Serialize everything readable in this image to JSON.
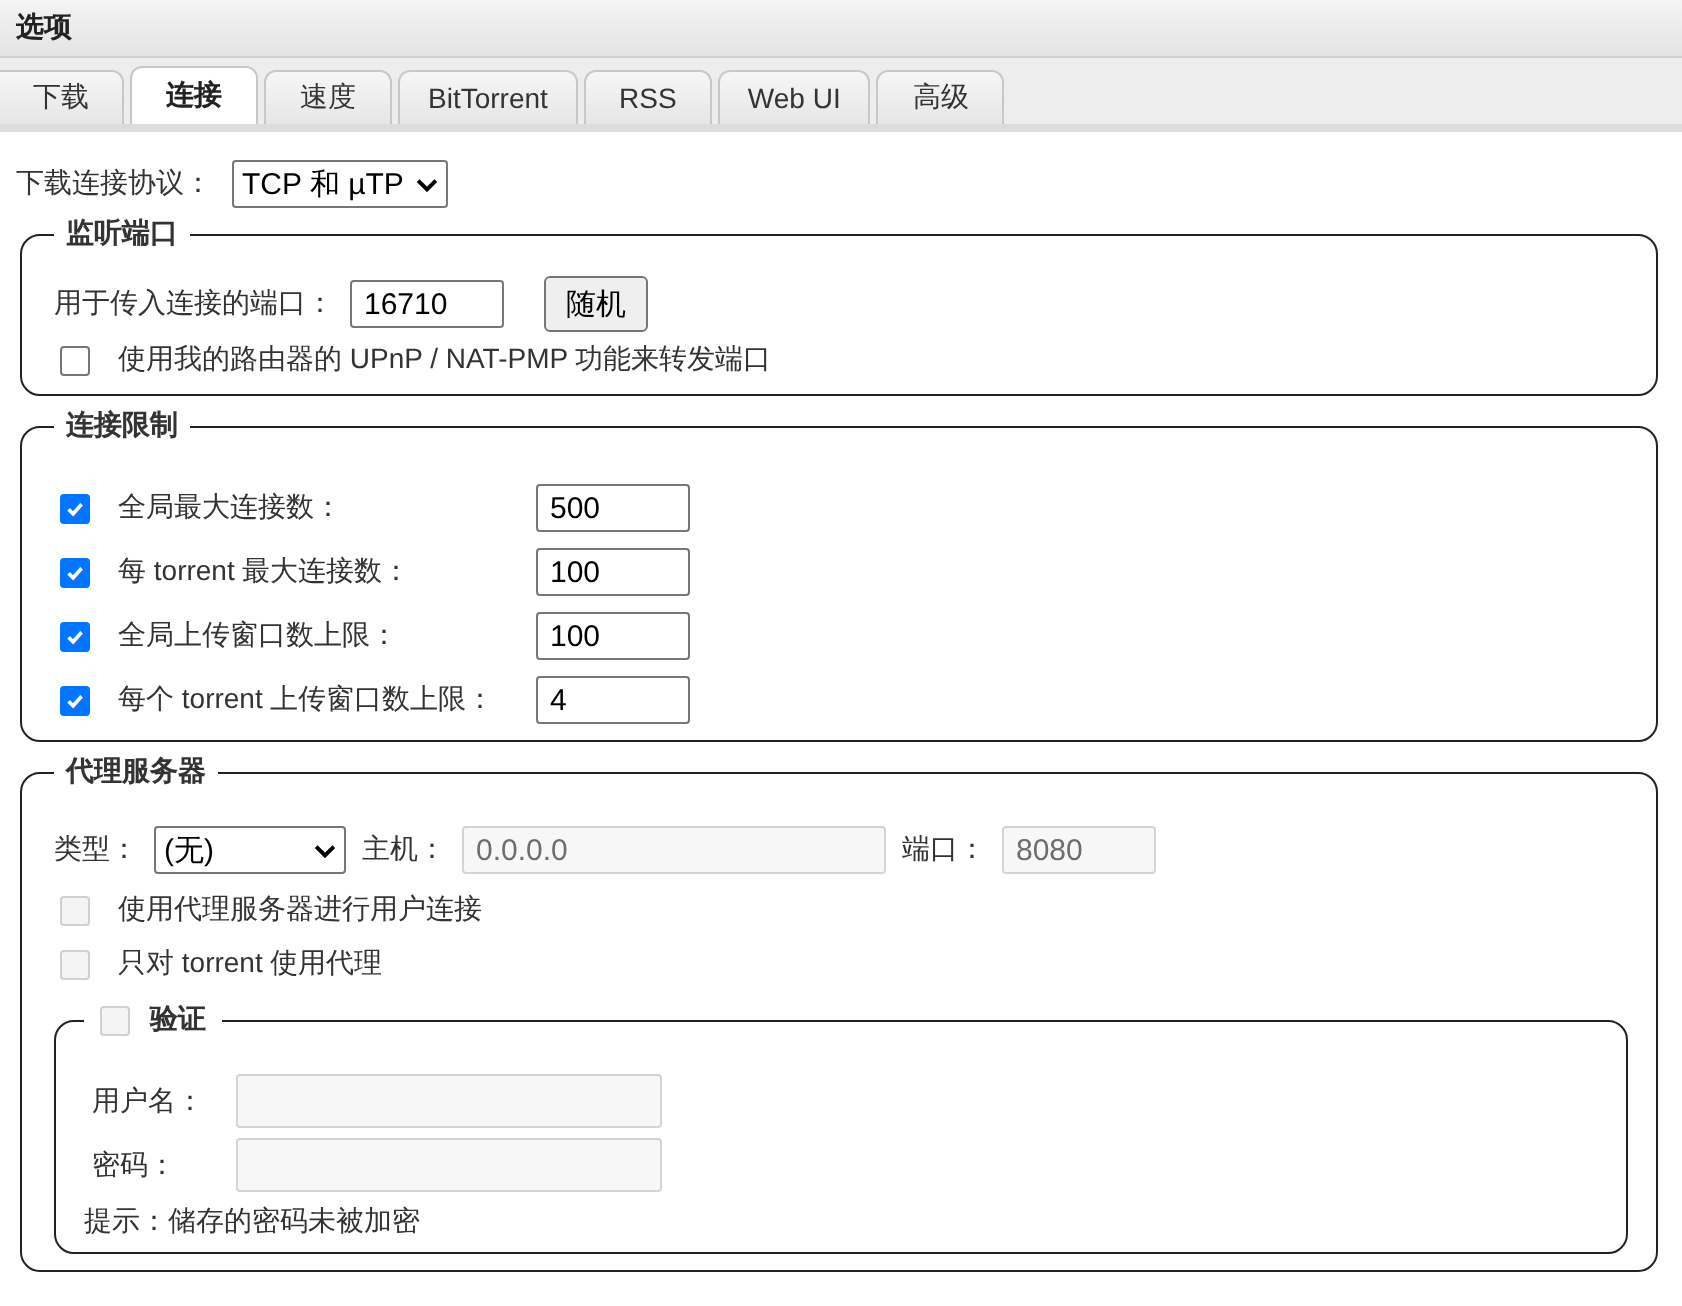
{
  "window": {
    "title": "选项"
  },
  "tabs": [
    {
      "label": "下载",
      "selected": false
    },
    {
      "label": "连接",
      "selected": true
    },
    {
      "label": "速度",
      "selected": false
    },
    {
      "label": "BitTorrent",
      "selected": false
    },
    {
      "label": "RSS",
      "selected": false
    },
    {
      "label": "Web UI",
      "selected": false
    },
    {
      "label": "高级",
      "selected": false
    }
  ],
  "protocol": {
    "label": "下载连接协议：",
    "value": "TCP 和 µTP"
  },
  "listening_port": {
    "title": "监听端口",
    "port_label": "用于传入连接的端口：",
    "port_value": "16710",
    "random_button": "随机",
    "upnp": {
      "label": "使用我的路由器的 UPnP / NAT-PMP 功能来转发端口",
      "checked": false,
      "disabled": false
    }
  },
  "connection_limits": {
    "title": "连接限制",
    "rows": [
      {
        "label": "全局最大连接数：",
        "checked": true,
        "value": "500"
      },
      {
        "label": "每 torrent 最大连接数：",
        "checked": true,
        "value": "100"
      },
      {
        "label": "全局上传窗口数上限：",
        "checked": true,
        "value": "100"
      },
      {
        "label": "每个 torrent 上传窗口数上限：",
        "checked": true,
        "value": "4"
      }
    ]
  },
  "proxy": {
    "title": "代理服务器",
    "type_label": "类型：",
    "type_value": "(无)",
    "host_label": "主机：",
    "host_value": "0.0.0.0",
    "port_label": "端口：",
    "port_value": "8080",
    "fields_disabled": true,
    "options": [
      {
        "label": "使用代理服务器进行用户连接",
        "checked": false,
        "disabled": true
      },
      {
        "label": "只对 torrent 使用代理",
        "checked": false,
        "disabled": true
      }
    ],
    "auth": {
      "title": "验证",
      "checked": false,
      "disabled": true,
      "username_label": "用户名：",
      "password_label": "密码：",
      "fields_disabled": true,
      "hint": "提示：储存的密码未被加密"
    }
  }
}
